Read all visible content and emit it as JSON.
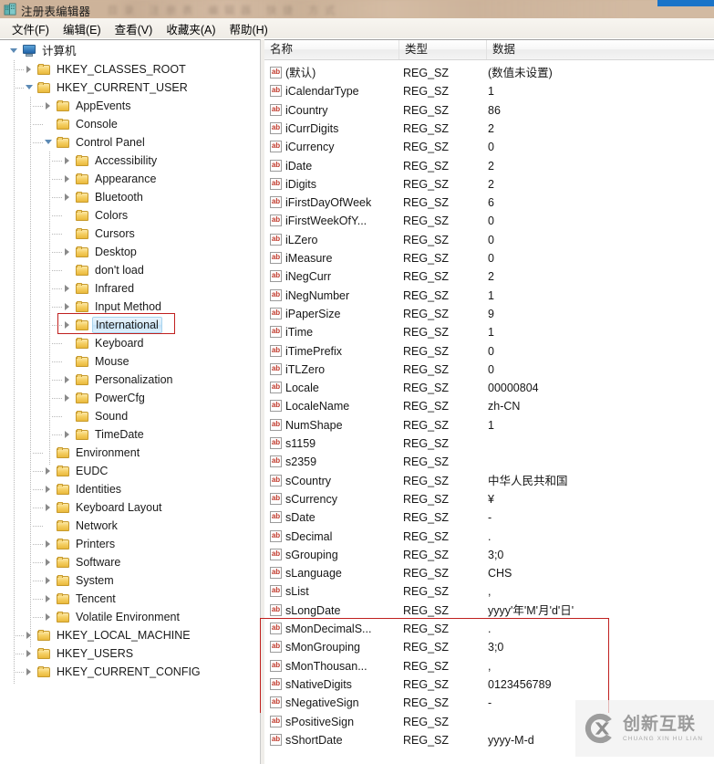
{
  "window": {
    "title": "注册表编辑器",
    "icon": "registry-editor-icon",
    "ghost_text": "目录  注册表  编辑器  快捷  方式"
  },
  "menu": {
    "items": [
      {
        "label": "文件(F)",
        "name": "menu-file"
      },
      {
        "label": "编辑(E)",
        "name": "menu-edit"
      },
      {
        "label": "查看(V)",
        "name": "menu-view"
      },
      {
        "label": "收藏夹(A)",
        "name": "menu-favorites"
      },
      {
        "label": "帮助(H)",
        "name": "menu-help"
      }
    ]
  },
  "tree": {
    "root_label": "计算机",
    "nodes": [
      {
        "label": "计算机",
        "depth": 0,
        "expander": "expanded",
        "icon": "computer-icon",
        "selected": false
      },
      {
        "label": "HKEY_CLASSES_ROOT",
        "depth": 1,
        "expander": "collapsed",
        "icon": "folder-icon",
        "selected": false
      },
      {
        "label": "HKEY_CURRENT_USER",
        "depth": 1,
        "expander": "expanded",
        "icon": "folder-icon",
        "selected": false
      },
      {
        "label": "AppEvents",
        "depth": 2,
        "expander": "collapsed",
        "icon": "folder-icon",
        "selected": false
      },
      {
        "label": "Console",
        "depth": 2,
        "expander": "none",
        "icon": "folder-icon",
        "selected": false
      },
      {
        "label": "Control Panel",
        "depth": 2,
        "expander": "expanded",
        "icon": "folder-icon",
        "selected": false
      },
      {
        "label": "Accessibility",
        "depth": 3,
        "expander": "collapsed",
        "icon": "folder-icon",
        "selected": false
      },
      {
        "label": "Appearance",
        "depth": 3,
        "expander": "collapsed",
        "icon": "folder-icon",
        "selected": false
      },
      {
        "label": "Bluetooth",
        "depth": 3,
        "expander": "collapsed",
        "icon": "folder-icon",
        "selected": false
      },
      {
        "label": "Colors",
        "depth": 3,
        "expander": "none",
        "icon": "folder-icon",
        "selected": false
      },
      {
        "label": "Cursors",
        "depth": 3,
        "expander": "none",
        "icon": "folder-icon",
        "selected": false
      },
      {
        "label": "Desktop",
        "depth": 3,
        "expander": "collapsed",
        "icon": "folder-icon",
        "selected": false
      },
      {
        "label": "don't load",
        "depth": 3,
        "expander": "none",
        "icon": "folder-icon",
        "selected": false
      },
      {
        "label": "Infrared",
        "depth": 3,
        "expander": "collapsed",
        "icon": "folder-icon",
        "selected": false
      },
      {
        "label": "Input Method",
        "depth": 3,
        "expander": "collapsed",
        "icon": "folder-icon",
        "selected": false
      },
      {
        "label": "International",
        "depth": 3,
        "expander": "collapsed",
        "icon": "folder-icon",
        "selected": true
      },
      {
        "label": "Keyboard",
        "depth": 3,
        "expander": "none",
        "icon": "folder-icon",
        "selected": false
      },
      {
        "label": "Mouse",
        "depth": 3,
        "expander": "none",
        "icon": "folder-icon",
        "selected": false
      },
      {
        "label": "Personalization",
        "depth": 3,
        "expander": "collapsed",
        "icon": "folder-icon",
        "selected": false
      },
      {
        "label": "PowerCfg",
        "depth": 3,
        "expander": "collapsed",
        "icon": "folder-icon",
        "selected": false
      },
      {
        "label": "Sound",
        "depth": 3,
        "expander": "none",
        "icon": "folder-icon",
        "selected": false
      },
      {
        "label": "TimeDate",
        "depth": 3,
        "expander": "collapsed",
        "icon": "folder-icon",
        "selected": false
      },
      {
        "label": "Environment",
        "depth": 2,
        "expander": "none",
        "icon": "folder-icon",
        "selected": false
      },
      {
        "label": "EUDC",
        "depth": 2,
        "expander": "collapsed",
        "icon": "folder-icon",
        "selected": false
      },
      {
        "label": "Identities",
        "depth": 2,
        "expander": "collapsed",
        "icon": "folder-icon",
        "selected": false
      },
      {
        "label": "Keyboard Layout",
        "depth": 2,
        "expander": "collapsed",
        "icon": "folder-icon",
        "selected": false
      },
      {
        "label": "Network",
        "depth": 2,
        "expander": "none",
        "icon": "folder-icon",
        "selected": false
      },
      {
        "label": "Printers",
        "depth": 2,
        "expander": "collapsed",
        "icon": "folder-icon",
        "selected": false
      },
      {
        "label": "Software",
        "depth": 2,
        "expander": "collapsed",
        "icon": "folder-icon",
        "selected": false
      },
      {
        "label": "System",
        "depth": 2,
        "expander": "collapsed",
        "icon": "folder-icon",
        "selected": false
      },
      {
        "label": "Tencent",
        "depth": 2,
        "expander": "collapsed",
        "icon": "folder-icon",
        "selected": false
      },
      {
        "label": "Volatile Environment",
        "depth": 2,
        "expander": "collapsed",
        "icon": "folder-icon",
        "selected": false
      },
      {
        "label": "HKEY_LOCAL_MACHINE",
        "depth": 1,
        "expander": "collapsed",
        "icon": "folder-icon",
        "selected": false
      },
      {
        "label": "HKEY_USERS",
        "depth": 1,
        "expander": "collapsed",
        "icon": "folder-icon",
        "selected": false
      },
      {
        "label": "HKEY_CURRENT_CONFIG",
        "depth": 1,
        "expander": "collapsed",
        "icon": "folder-icon",
        "selected": false
      }
    ]
  },
  "list": {
    "columns": [
      {
        "label": "名称",
        "name": "column-header-name"
      },
      {
        "label": "类型",
        "name": "column-header-type"
      },
      {
        "label": "数据",
        "name": "column-header-data"
      }
    ],
    "rows": [
      {
        "name": "(默认)",
        "type": "REG_SZ",
        "data": "(数值未设置)"
      },
      {
        "name": "iCalendarType",
        "type": "REG_SZ",
        "data": "1"
      },
      {
        "name": "iCountry",
        "type": "REG_SZ",
        "data": "86"
      },
      {
        "name": "iCurrDigits",
        "type": "REG_SZ",
        "data": "2"
      },
      {
        "name": "iCurrency",
        "type": "REG_SZ",
        "data": "0"
      },
      {
        "name": "iDate",
        "type": "REG_SZ",
        "data": "2"
      },
      {
        "name": "iDigits",
        "type": "REG_SZ",
        "data": "2"
      },
      {
        "name": "iFirstDayOfWeek",
        "type": "REG_SZ",
        "data": "6"
      },
      {
        "name": "iFirstWeekOfY...",
        "type": "REG_SZ",
        "data": "0"
      },
      {
        "name": "iLZero",
        "type": "REG_SZ",
        "data": "0"
      },
      {
        "name": "iMeasure",
        "type": "REG_SZ",
        "data": "0"
      },
      {
        "name": "iNegCurr",
        "type": "REG_SZ",
        "data": "2"
      },
      {
        "name": "iNegNumber",
        "type": "REG_SZ",
        "data": "1"
      },
      {
        "name": "iPaperSize",
        "type": "REG_SZ",
        "data": "9"
      },
      {
        "name": "iTime",
        "type": "REG_SZ",
        "data": "1"
      },
      {
        "name": "iTimePrefix",
        "type": "REG_SZ",
        "data": "0"
      },
      {
        "name": "iTLZero",
        "type": "REG_SZ",
        "data": "0"
      },
      {
        "name": "Locale",
        "type": "REG_SZ",
        "data": "00000804"
      },
      {
        "name": "LocaleName",
        "type": "REG_SZ",
        "data": "zh-CN"
      },
      {
        "name": "NumShape",
        "type": "REG_SZ",
        "data": "1"
      },
      {
        "name": "s1159",
        "type": "REG_SZ",
        "data": ""
      },
      {
        "name": "s2359",
        "type": "REG_SZ",
        "data": ""
      },
      {
        "name": "sCountry",
        "type": "REG_SZ",
        "data": "中华人民共和国"
      },
      {
        "name": "sCurrency",
        "type": "REG_SZ",
        "data": "¥"
      },
      {
        "name": "sDate",
        "type": "REG_SZ",
        "data": "-"
      },
      {
        "name": "sDecimal",
        "type": "REG_SZ",
        "data": "."
      },
      {
        "name": "sGrouping",
        "type": "REG_SZ",
        "data": "3;0"
      },
      {
        "name": "sLanguage",
        "type": "REG_SZ",
        "data": "CHS"
      },
      {
        "name": "sList",
        "type": "REG_SZ",
        "data": ","
      },
      {
        "name": "sLongDate",
        "type": "REG_SZ",
        "data": "yyyy'年'M'月'd'日'"
      },
      {
        "name": "sMonDecimalS...",
        "type": "REG_SZ",
        "data": "."
      },
      {
        "name": "sMonGrouping",
        "type": "REG_SZ",
        "data": "3;0"
      },
      {
        "name": "sMonThousan...",
        "type": "REG_SZ",
        "data": ","
      },
      {
        "name": "sNativeDigits",
        "type": "REG_SZ",
        "data": "0123456789"
      },
      {
        "name": "sNegativeSign",
        "type": "REG_SZ",
        "data": "-"
      },
      {
        "name": "sPositiveSign",
        "type": "REG_SZ",
        "data": ""
      },
      {
        "name": "sShortDate",
        "type": "REG_SZ",
        "data": "yyyy-M-d"
      }
    ]
  },
  "annotations": {
    "tree_highlight_target": "International",
    "list_highlight_start": "sLongDate",
    "color": "#c0201f"
  },
  "watermark": {
    "cn": "创新互联",
    "en": "CHUANG XIN HU LIAN",
    "logo": "cx-circle-logo"
  },
  "colors": {
    "title_bar": "#cdb39a",
    "accent_blue": "#1a74c8",
    "selection": "#c4e2f7",
    "annotation_red": "#c0201f"
  }
}
